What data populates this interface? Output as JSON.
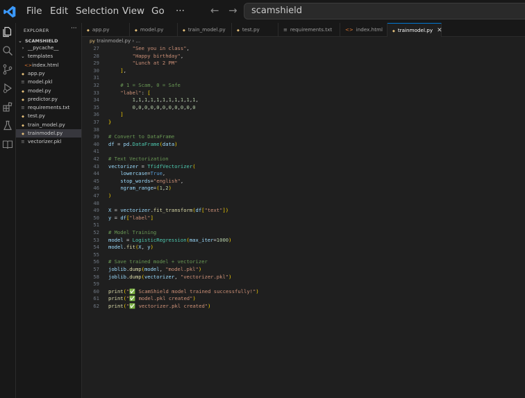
{
  "titlebar": {
    "menu": [
      "File",
      "Edit",
      "Selection",
      "View",
      "Go"
    ],
    "more": "···",
    "search_text": "scamshield"
  },
  "activity_icons": [
    "files-icon",
    "search-icon",
    "source-control-icon",
    "run-debug-icon",
    "extensions-icon",
    "testing-icon",
    "books-icon"
  ],
  "sidebar": {
    "header": "EXPLORER",
    "more": "···",
    "project": "SCAMSHIELD",
    "items": [
      {
        "label": "__pycache__",
        "icon": "›",
        "indent": 1
      },
      {
        "label": "templates",
        "icon": "⌄",
        "indent": 1
      },
      {
        "label": "index.html",
        "icon": "<>",
        "indent": 2
      },
      {
        "label": "app.py",
        "icon": "py",
        "indent": 1
      },
      {
        "label": "model.pkl",
        "icon": "≡",
        "indent": 1
      },
      {
        "label": "model.py",
        "icon": "py",
        "indent": 1
      },
      {
        "label": "predictor.py",
        "icon": "py",
        "indent": 1
      },
      {
        "label": "requirements.txt",
        "icon": "≡",
        "indent": 1
      },
      {
        "label": "test.py",
        "icon": "py",
        "indent": 1
      },
      {
        "label": "train_model.py",
        "icon": "py",
        "indent": 1
      },
      {
        "label": "trainmodel.py",
        "icon": "py",
        "indent": 1,
        "selected": true
      },
      {
        "label": "vectorizer.pkl",
        "icon": "≡",
        "indent": 1
      }
    ]
  },
  "tabs": [
    {
      "label": "app.py",
      "icon": "py"
    },
    {
      "label": "model.py",
      "icon": "py"
    },
    {
      "label": "train_model.py",
      "icon": "py"
    },
    {
      "label": "test.py",
      "icon": "py"
    },
    {
      "label": "requirements.txt",
      "icon": "≡"
    },
    {
      "label": "index.html",
      "icon": "<>"
    },
    {
      "label": "trainmodel.py",
      "icon": "py",
      "active": true,
      "close": "✕"
    }
  ],
  "breadcrumb": "trainmodel.py › ...",
  "colors": {
    "accent": "#0078d4",
    "python_icon": "#e5c07b",
    "html_icon": "#e37933",
    "vscode_blue": "#3b99fc"
  },
  "code": [
    {
      "n": "27",
      "t": "        \"See you in class\","
    },
    {
      "n": "28",
      "t": "        \"Happy birthday\","
    },
    {
      "n": "29",
      "t": "        \"Lunch at 2 PM\""
    },
    {
      "n": "30",
      "t": "    ],"
    },
    {
      "n": "31",
      "t": ""
    },
    {
      "n": "32",
      "t": "    # 1 = Scam, 0 = Safe"
    },
    {
      "n": "33",
      "t": "    \"label\": ["
    },
    {
      "n": "34",
      "t": "        1,1,1,1,1,1,1,1,1,1,1,"
    },
    {
      "n": "35",
      "t": "        0,0,0,0,0,0,0,0,0,0,0"
    },
    {
      "n": "36",
      "t": "    ]"
    },
    {
      "n": "37",
      "t": "}"
    },
    {
      "n": "38",
      "t": ""
    },
    {
      "n": "39",
      "t": "# Convert to DataFrame"
    },
    {
      "n": "40",
      "t": "df = pd.DataFrame(data)"
    },
    {
      "n": "41",
      "t": ""
    },
    {
      "n": "42",
      "t": "# Text Vectorization"
    },
    {
      "n": "43",
      "t": "vectorizer = TfidfVectorizer("
    },
    {
      "n": "44",
      "t": "    lowercase=True,"
    },
    {
      "n": "45",
      "t": "    stop_words=\"english\","
    },
    {
      "n": "46",
      "t": "    ngram_range=(1,2)"
    },
    {
      "n": "47",
      "t": ")"
    },
    {
      "n": "48",
      "t": ""
    },
    {
      "n": "49",
      "t": "X = vectorizer.fit_transform(df[\"text\"])"
    },
    {
      "n": "50",
      "t": "y = df[\"label\"]"
    },
    {
      "n": "51",
      "t": ""
    },
    {
      "n": "52",
      "t": "# Model Training"
    },
    {
      "n": "53",
      "t": "model = LogisticRegression(max_iter=1000)"
    },
    {
      "n": "54",
      "t": "model.fit(X, y)"
    },
    {
      "n": "55",
      "t": ""
    },
    {
      "n": "56",
      "t": "# Save trained model + vectorizer"
    },
    {
      "n": "57",
      "t": "joblib.dump(model, \"model.pkl\")"
    },
    {
      "n": "58",
      "t": "joblib.dump(vectorizer, \"vectorizer.pkl\")"
    },
    {
      "n": "59",
      "t": ""
    },
    {
      "n": "60",
      "t": "print(\"✅ ScamShield model trained successfully!\")"
    },
    {
      "n": "61",
      "t": "print(\"✅ model.pkl created\")"
    },
    {
      "n": "62",
      "t": "print(\"✅ vectorizer.pkl created\")"
    }
  ]
}
